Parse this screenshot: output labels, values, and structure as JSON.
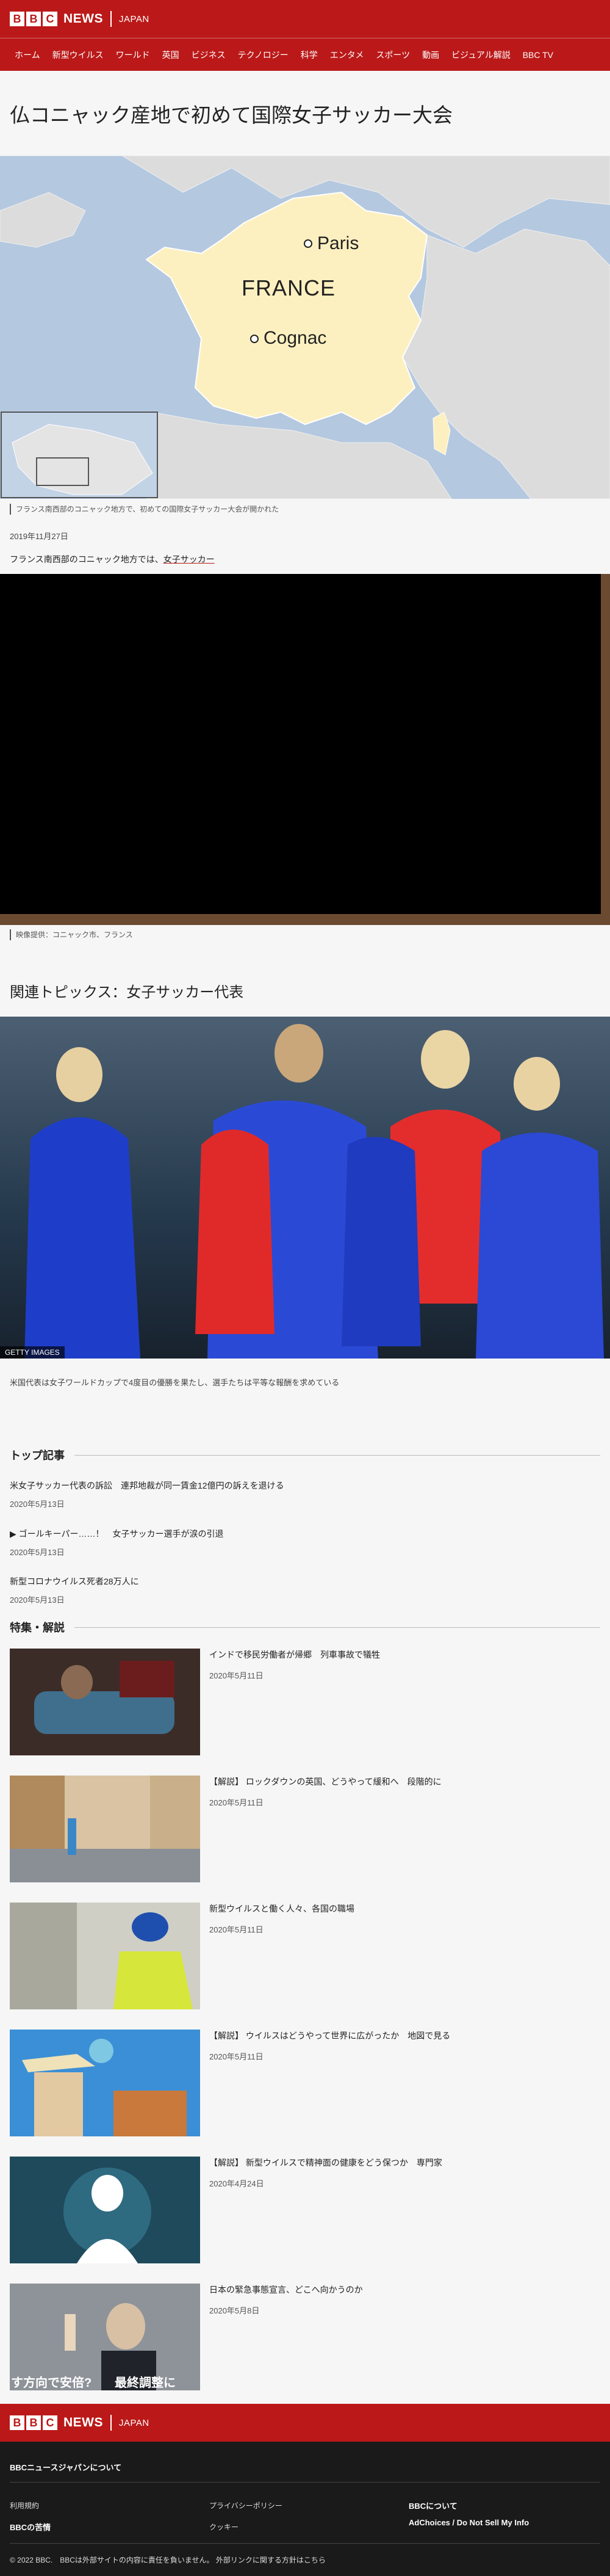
{
  "header": {
    "brand_letters": [
      "B",
      "B",
      "C"
    ],
    "brand_news": "NEWS",
    "brand_region": "JAPAN",
    "nav": [
      "ホーム",
      "新型ウイルス",
      "ワールド",
      "英国",
      "ビジネス",
      "テクノロジー",
      "科学",
      "エンタメ",
      "スポーツ",
      "動画",
      "ビジュアル解説",
      "BBC TV"
    ]
  },
  "article": {
    "headline": "仏コニャック産地で初めて国際女子サッカー大会",
    "map_labels": {
      "paris": "Paris",
      "country": "FRANCE",
      "cognac": "Cognac"
    },
    "map_caption": "フランス南西部のコニャック地方で、初めての国際女子サッカー大会が開かれた",
    "date": "2019年11月27日",
    "intro_text": "フランス南西部のコニャック地方では、",
    "intro_link": "女子サッカー",
    "video_caption": "映像提供：コニャック市、フランス",
    "section_heading": "関連トピックス：女子サッカー代表",
    "photo_credit": "GETTY IMAGES",
    "photo_caption": "米国代表は女子ワールドカップで4度目の優勝を果たし、選手たちは平等な報酬を求めている"
  },
  "top_stories": {
    "title": "トップ記事",
    "items": [
      {
        "title": "米女子サッカー代表の訴訟　連邦地裁が同一賃金12億円の訴えを退ける",
        "date": "2020年5月13日"
      },
      {
        "title": "▶ ゴールキーパー……！　女子サッカー選手が涙の引退",
        "date": "2020年5月13日"
      },
      {
        "title": "新型コロナウイルス死者28万人に",
        "date": "2020年5月13日"
      }
    ]
  },
  "features": {
    "title": "特集・解説",
    "items": [
      {
        "title": "インドで移民労働者が帰郷　列車事故で犠牲",
        "date": "2020年5月11日"
      },
      {
        "title": "【解説】 ロックダウンの英国、どうやって緩和へ　段階的に",
        "date": "2020年5月11日"
      },
      {
        "title": "新型ウイルスと働く人々、各国の職場",
        "date": "2020年5月11日"
      },
      {
        "title": "【解説】 ウイルスはどうやって世界に広がったか　地図で見る",
        "date": "2020年5月11日"
      },
      {
        "title": "【解説】 新型ウイルスで精神面の健康をどう保つか　専門家",
        "date": "2020年4月24日"
      },
      {
        "title": "日本の緊急事態宣言、どこへ向かうのか",
        "date": "2020年5月8日",
        "thumb_text_left": "す方向で安倍?",
        "thumb_text_right": "最終調整に"
      }
    ]
  },
  "footer": {
    "brand_letters": [
      "B",
      "B",
      "C"
    ],
    "brand_news": "NEWS",
    "brand_region": "JAPAN",
    "tagline": "BBCニュースジャパンについて",
    "links": [
      "利用規約",
      "プライバシーポリシー",
      "BBCについて",
      "BBCの苦情",
      "クッキー",
      "AdChoices / Do Not Sell My Info"
    ],
    "copyright": "© 2022 BBC.　BBCは外部サイトの内容に責任を負いません。 外部リンクに関する方針はこちら"
  },
  "colors": {
    "brand_red": "#bb1919",
    "map_france": "#fdf0c0",
    "map_sea": "#b4c8e0",
    "footer_bg": "#1a1a1a"
  }
}
